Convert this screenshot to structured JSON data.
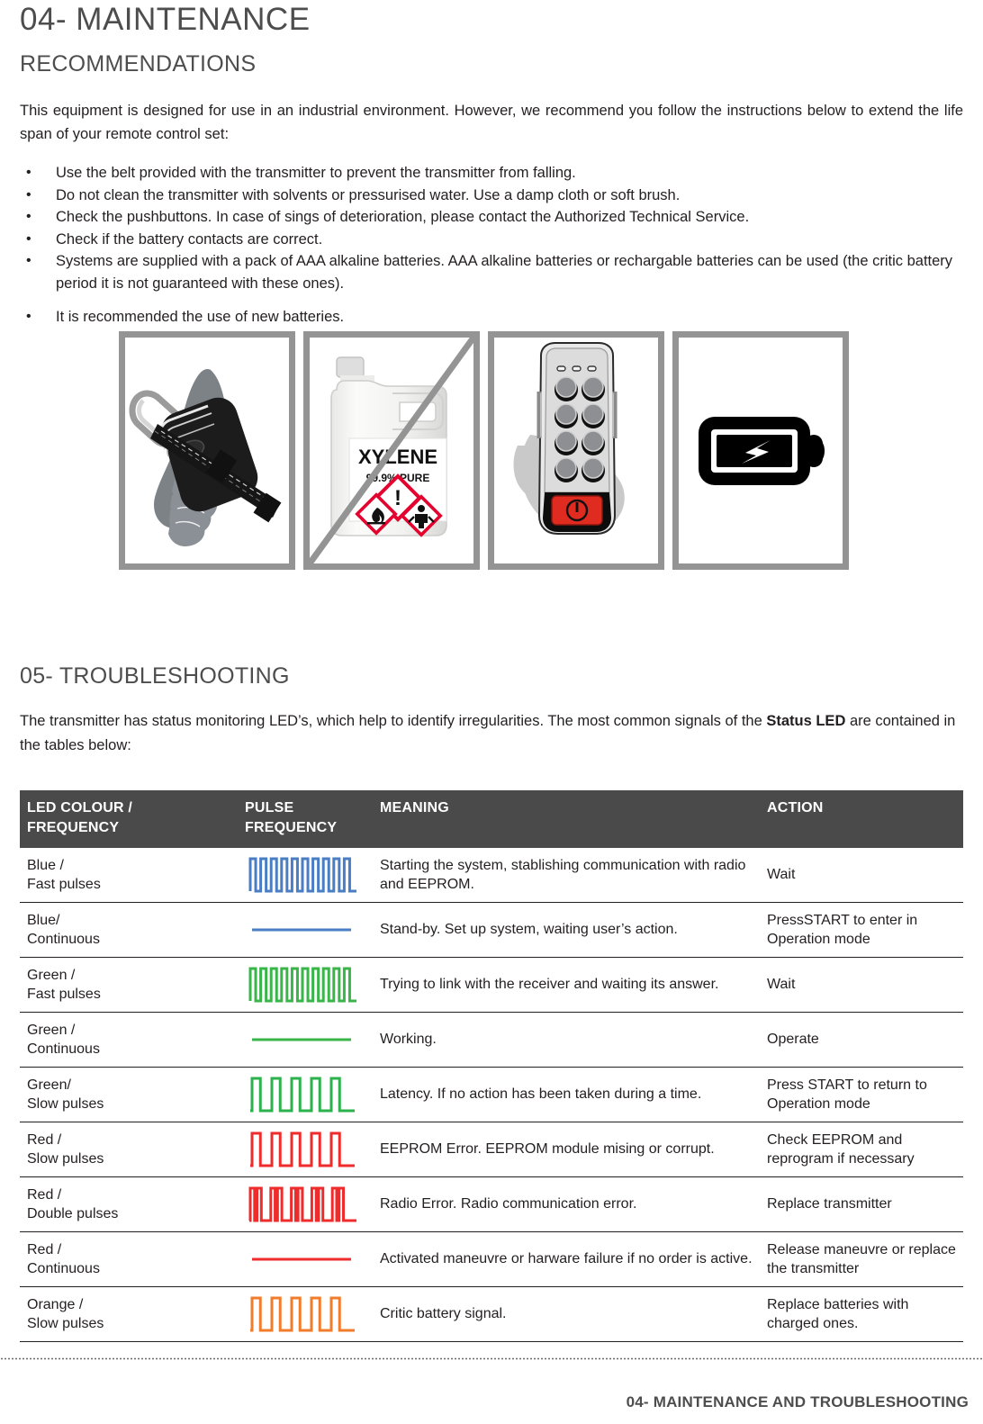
{
  "chapter": {
    "title": "04- MAINTENANCE"
  },
  "recommendations": {
    "section_title": "RECOMMENDATIONS",
    "intro": "This equipment is designed for use in an industrial environment. However, we recommend you follow the instructions below to extend the life span of your remote control set:",
    "bullets": [
      "Use the belt provided with the transmitter to prevent the transmitter from falling.",
      "Do not clean the transmitter with solvents or pressurised water. Use a damp cloth or soft brush.",
      "Check the pushbuttons. In case of sings of deterioration, please contact the Authorized Technical Service.",
      "Check if the battery contacts are correct.",
      "Systems are supplied with a pack of AAA alkaline batteries. AAA alkaline batteries or rechargable batteries can be used (the critic battery period it is not guaranteed with these ones).",
      "It is recommended the use of new batteries."
    ],
    "bullet_glyph": "•",
    "figures": [
      {
        "name": "hand-holding-transmitter-with-belt",
        "crossed_out": false,
        "label": ""
      },
      {
        "name": "xylene-solvent-container",
        "crossed_out": true,
        "label": "XYLENE",
        "sublabel": "99.9% PURE"
      },
      {
        "name": "transmitter-pushbuttons",
        "crossed_out": false,
        "label": ""
      },
      {
        "name": "battery-icon",
        "crossed_out": false,
        "label": ""
      }
    ]
  },
  "troubleshooting": {
    "section_title": "05- TROUBLESHOOTING",
    "intro_part1": "The transmitter has status monitoring LED’s, which help to identify irregularities. The most common signals of the ",
    "intro_bold": "Status LED",
    "intro_part2": " are contained in the tables below:",
    "table": {
      "headers": {
        "led_colour": "LED COLOUR /\nFREQUENCY",
        "led_colour_line1": "LED COLOUR /",
        "led_colour_line2": "FREQUENCY",
        "pulse_line1": "PULSE",
        "pulse_line2": "FREQUENCY",
        "meaning": "MEANING",
        "action": "ACTION"
      },
      "rows": [
        {
          "led_line1": "Blue /",
          "led_line2": "Fast pulses",
          "pulse_type": "fast",
          "pulse_color": "#4a7ec4",
          "meaning": "Starting the system, stablishing communication with radio and EEPROM.",
          "action": "Wait"
        },
        {
          "led_line1": "Blue/",
          "led_line2": "Continuous",
          "pulse_type": "continuous",
          "pulse_color": "#4a7ec4",
          "meaning": "Stand-by.  Set up system, waiting user’s action.",
          "action": "PressSTART to enter in Operation mode"
        },
        {
          "led_line1": "Green /",
          "led_line2": "Fast pulses",
          "pulse_type": "fast",
          "pulse_color": "#3ab54a",
          "meaning": "Trying to link with the receiver and waiting its answer.",
          "action": "Wait"
        },
        {
          "led_line1": "Green /",
          "led_line2": "Continuous",
          "pulse_type": "continuous",
          "pulse_color": "#3ab54a",
          "meaning": "Working.",
          "action": "Operate"
        },
        {
          "led_line1": "Green/",
          "led_line2": "Slow pulses",
          "pulse_type": "slow",
          "pulse_color": "#2bb24c",
          "meaning": "Latency. If no action has been taken during a time.",
          "action": "Press START to return to Operation mode"
        },
        {
          "led_line1": "Red /",
          "led_line2": "Slow pulses",
          "pulse_type": "slow",
          "pulse_color": "#ee2c2c",
          "meaning": "EEPROM Error. EEPROM module mising or corrupt.",
          "action": "Check EEPROM and reprogram if necessary"
        },
        {
          "led_line1": "Red /",
          "led_line2": "Double pulses",
          "pulse_type": "double",
          "pulse_color": "#ee2c2c",
          "meaning": "Radio Error. Radio communication error.",
          "action": "Replace transmitter"
        },
        {
          "led_line1": "Red /",
          "led_line2": "Continuous",
          "pulse_type": "continuous",
          "pulse_color": "#ee2c2c",
          "meaning": "Activated maneuvre or harware failure if no order is active.",
          "action": "Release maneuvre or replace the transmitter"
        },
        {
          "led_line1": "Orange /",
          "led_line2": "Slow pulses",
          "pulse_type": "slow",
          "pulse_color": "#f07c2c",
          "meaning": "Critic battery signal.",
          "action": "Replace batteries with charged ones."
        }
      ]
    }
  },
  "footer": {
    "text": "04- MAINTENANCE AND TROUBLESHOOTING"
  }
}
